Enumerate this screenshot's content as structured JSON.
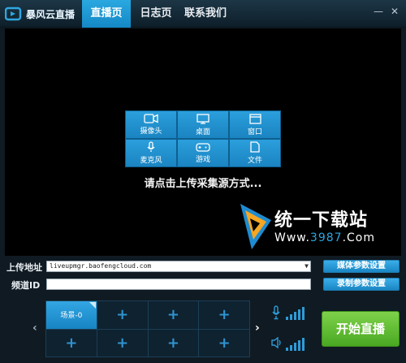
{
  "app": {
    "logo_text": "暴风云直播"
  },
  "tabs": [
    {
      "label": "直播页",
      "active": true
    },
    {
      "label": "日志页",
      "active": false
    },
    {
      "label": "联系我们",
      "active": false
    }
  ],
  "window_controls": {
    "minimize": "—",
    "close": "✕"
  },
  "preview": {
    "sources": [
      {
        "label": "摄像头",
        "icon": "camera-icon"
      },
      {
        "label": "桌面",
        "icon": "monitor-icon"
      },
      {
        "label": "窗口",
        "icon": "window-icon"
      },
      {
        "label": "麦克风",
        "icon": "microphone-icon"
      },
      {
        "label": "游戏",
        "icon": "gamepad-icon"
      },
      {
        "label": "文件",
        "icon": "file-icon"
      }
    ],
    "hint": "请点击上传采集源方式..."
  },
  "watermark": {
    "title": "统一下载站",
    "url_prefix": "Www.",
    "url_accent": "3987",
    "url_suffix": ".Com"
  },
  "upload": {
    "label": "上传地址",
    "value": "liveupmgr.baofengcloud.com"
  },
  "channel": {
    "label": "频道ID",
    "value": ""
  },
  "buttons": {
    "media_settings": "媒体参数设置",
    "record_settings": "录制参数设置",
    "start": "开始直播"
  },
  "scenes": {
    "items": [
      "场景-0",
      "+",
      "+",
      "+",
      "+",
      "+",
      "+",
      "+"
    ],
    "prev": "‹",
    "next": "›"
  },
  "colors": {
    "accent": "#1a86c4",
    "start_green": "#49a822"
  }
}
